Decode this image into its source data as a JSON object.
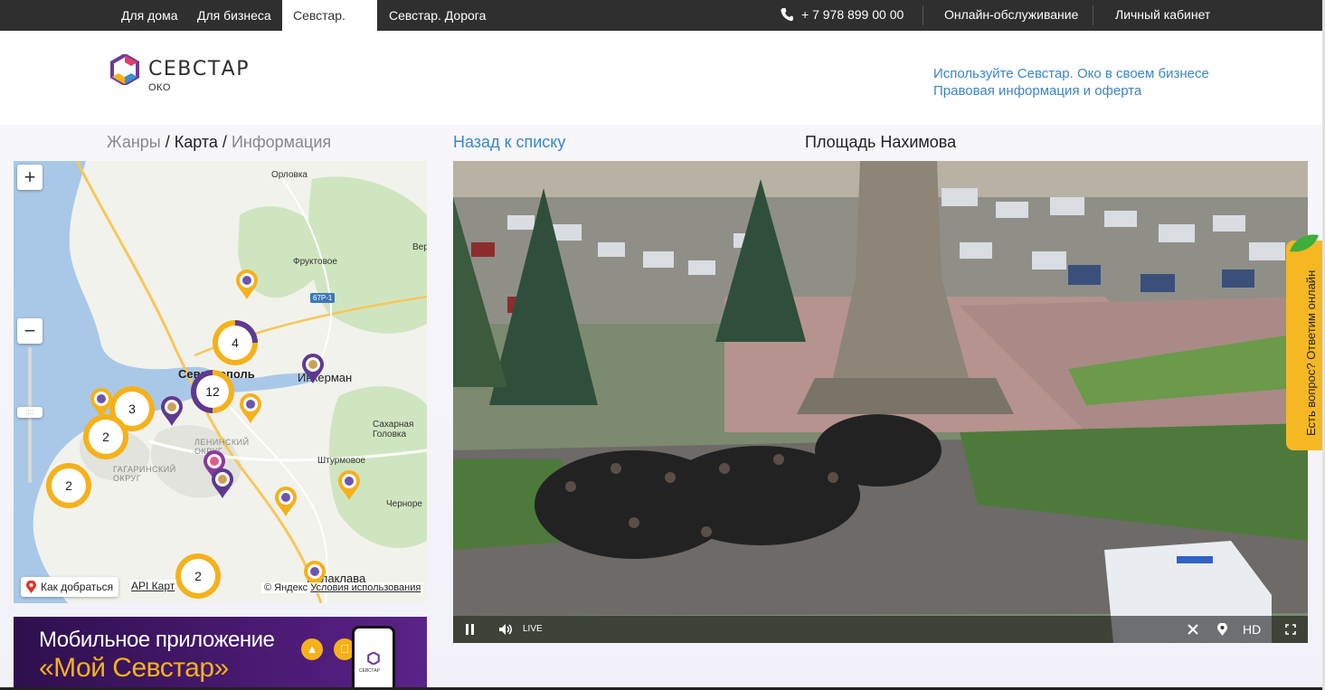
{
  "topnav": {
    "tabs": [
      "Для дома",
      "Для бизнеса",
      "Севстар. Око",
      "Севстар. Дорога"
    ],
    "active_tab": "Севстар. Око",
    "phone": "+ 7 978 899 00 00",
    "online_service": "Онлайн-обслуживание",
    "account": "Личный кабинет"
  },
  "logo": {
    "name": "СЕВСТАР",
    "sub": "ОКО"
  },
  "header_links": [
    "Используйте Севстар. Око в своем бизнесе",
    "Правовая информация и оферта"
  ],
  "breadcrumbs": {
    "genres": "Жанры",
    "sep": " / ",
    "map": "Карта",
    "info": "Информация"
  },
  "back_link": "Назад к списку",
  "camera_title": "Площадь Нахимова",
  "map": {
    "zoom_in": "+",
    "zoom_out": "−",
    "handle": "::::",
    "labels": {
      "orlovka": "Орловка",
      "fruktovoe": "Фруктовое",
      "ver": "Вер",
      "sevastopol": "Севастополь",
      "inkerman": "Инкерман",
      "sakharnaya": "Сахарная\nГоловка",
      "leninsky": "ЛЕНИНСКИЙ\nОКРУГ",
      "gagarinsky": "ГАГАРИНСКИЙ\nОКРУГ",
      "shturmovoe": "Штурмовое",
      "chernore": "Черноре",
      "balaklava": "Балаклава"
    },
    "road": "67Р-1",
    "clusters": [
      "4",
      "12",
      "3",
      "2",
      "2",
      "2"
    ],
    "route_button": "Как добраться",
    "api_link": "API Карт",
    "copyright": "© Яндекс",
    "terms": "Условия использования"
  },
  "banner": {
    "line1": "Мобильное приложение",
    "line2": "«Мой Севстар»",
    "android_icon": "android-icon",
    "apple_icon": "apple-icon",
    "phone_brand": "СЕВСТАР"
  },
  "video": {
    "live": "LIVE",
    "quality": "HD",
    "pause_icon": "pause-icon",
    "volume_icon": "volume-icon",
    "close_icon": "close-icon",
    "location_icon": "location-icon",
    "fullscreen_icon": "fullscreen-icon"
  },
  "chat_tab": "Есть вопрос? Ответим онлайн",
  "colors": {
    "nav_bg": "#2f2f2f",
    "link": "#3b86c5",
    "cluster": "#f5b11b",
    "pin_purple": "#5e3a8f",
    "banner_bg": "#3a145f",
    "chat_tab": "#f5b823"
  }
}
